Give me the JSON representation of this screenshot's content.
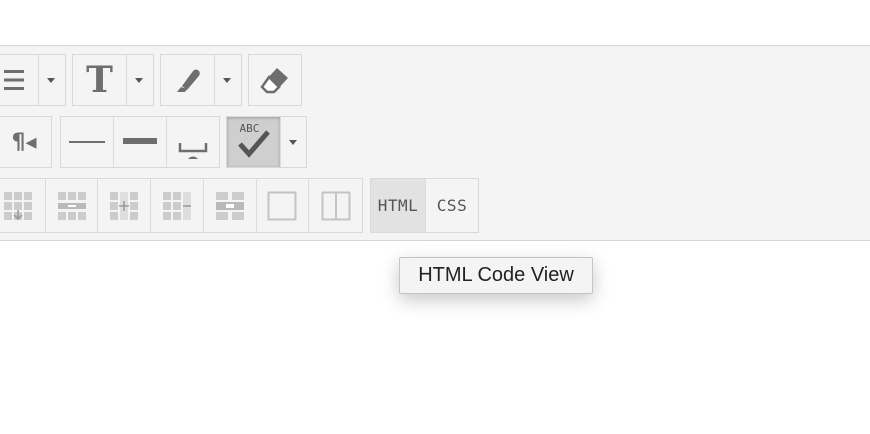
{
  "toolbar": {
    "row1": {
      "list_icon": "list-icon",
      "text_style_icon": "text-style-icon",
      "text_style_glyph": "T",
      "highlight_icon": "highlighter-icon",
      "eraser_icon": "eraser-icon"
    },
    "row2": {
      "paragraph_icon": "paragraph-direction-icon",
      "paragraph_glyph": "¶◂",
      "thin_rule_icon": "thin-horizontal-rule-icon",
      "thick_rule_icon": "thick-horizontal-rule-icon",
      "space_icon": "nonbreaking-space-icon",
      "spellcheck_icon": "spellcheck-icon",
      "spellcheck_glyph": "ABC"
    },
    "row3": {
      "table_icons": [
        "insert-row-below-icon",
        "delete-row-icon",
        "insert-column-icon",
        "delete-column-icon",
        "merge-cells-icon",
        "table-border-icon",
        "split-cell-icon"
      ],
      "html_label": "HTML",
      "css_label": "CSS"
    }
  },
  "tooltip": {
    "text": "HTML Code View"
  },
  "colors": {
    "toolbar_bg": "#f4f4f4",
    "icon_gray": "#6e6e6e",
    "pressed_bg": "#cfcfcf",
    "border": "#d9d9d9"
  }
}
